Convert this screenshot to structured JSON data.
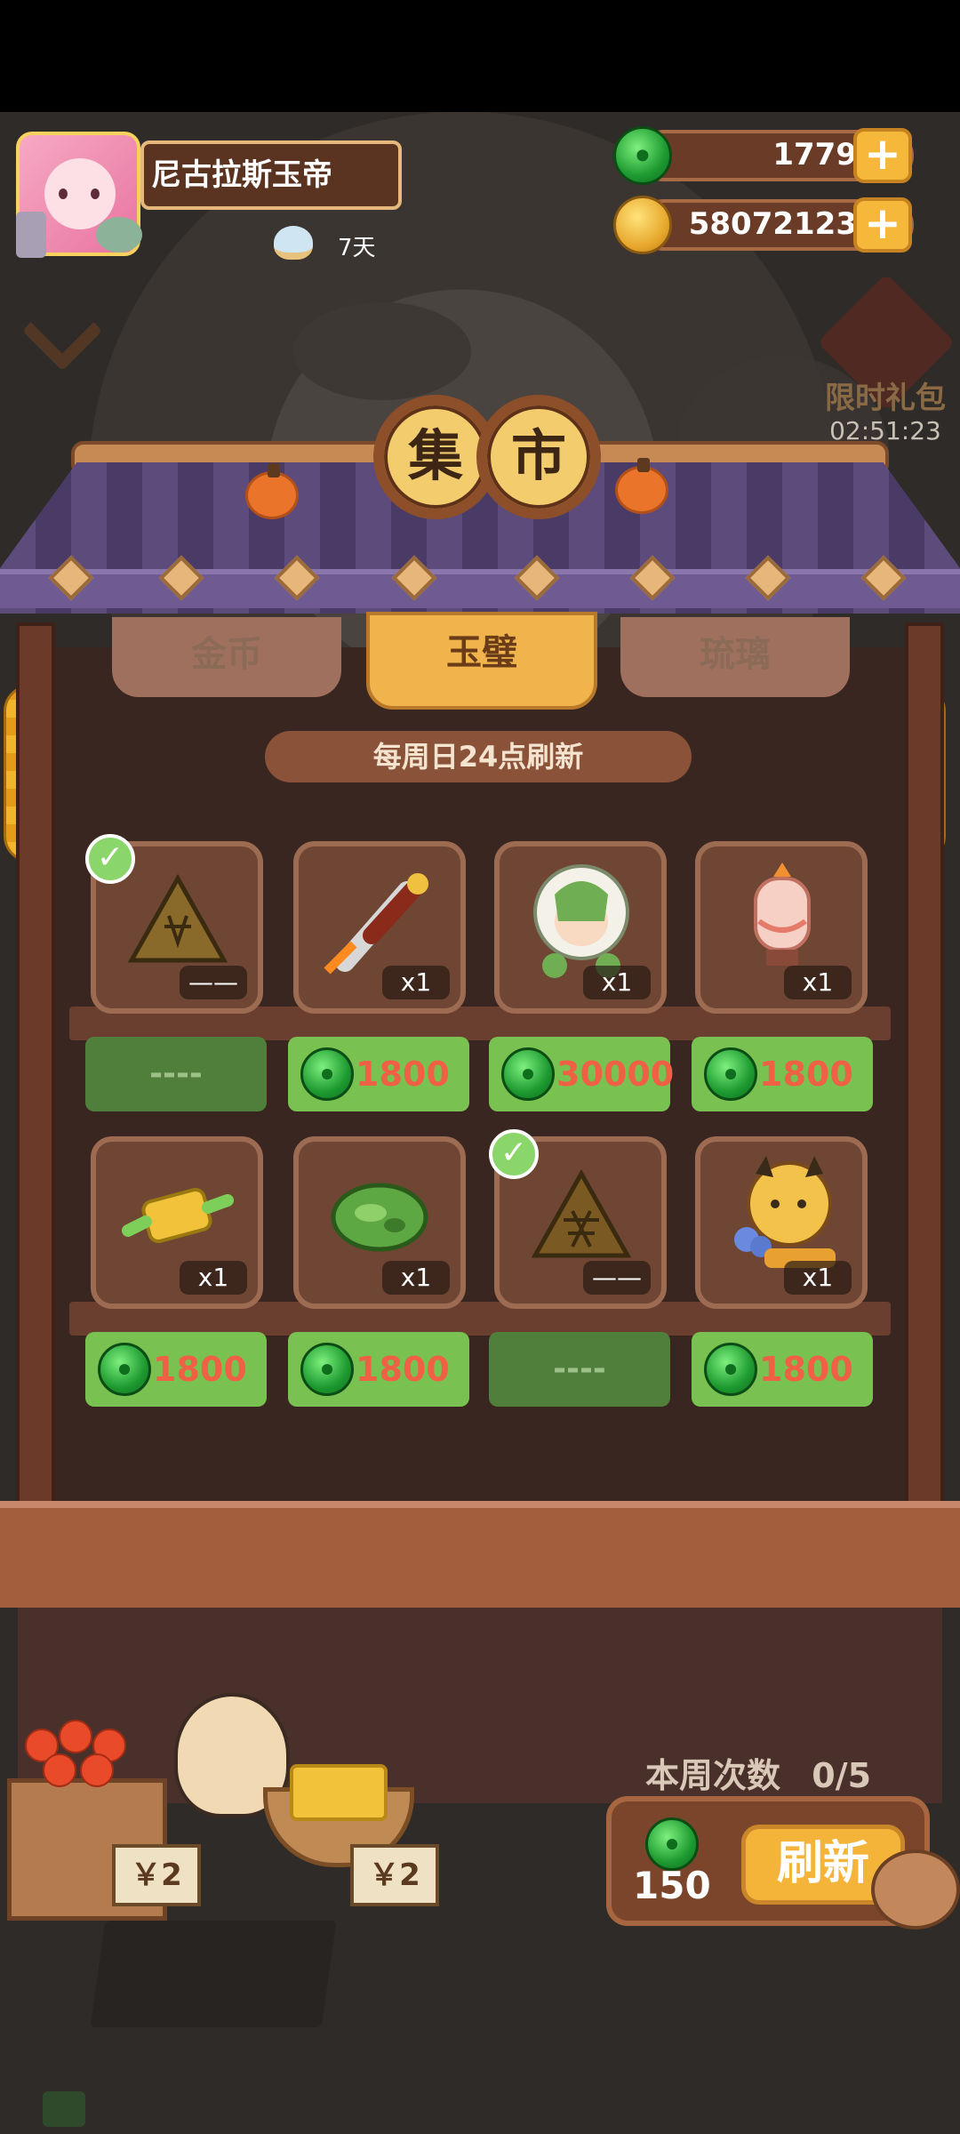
{
  "profile": {
    "name": "尼古拉斯玉帝",
    "days": "7天"
  },
  "currencies": {
    "jade": "1779",
    "gold": "58072123"
  },
  "limited_pack": {
    "label": "限时礼包",
    "timer": "02:51:23"
  },
  "market_title": [
    "集",
    "市"
  ],
  "tabs": [
    {
      "label": "金币",
      "active": false
    },
    {
      "label": "玉璧",
      "active": true
    },
    {
      "label": "琉璃",
      "active": false
    }
  ],
  "refresh_note": "每周日24点刷新",
  "items": [
    {
      "name": "sketch-triangle",
      "qty": "——",
      "price": "----",
      "purchased": true
    },
    {
      "name": "ornate-brush",
      "qty": "x1",
      "price": "1800",
      "purchased": false
    },
    {
      "name": "green-hooded-character",
      "qty": "x1",
      "price": "30000",
      "purchased": false
    },
    {
      "name": "lantern",
      "qty": "x1",
      "price": "1800",
      "purchased": false
    },
    {
      "name": "jade-pendant",
      "qty": "x1",
      "price": "1800",
      "purchased": false
    },
    {
      "name": "jade-stone",
      "qty": "x1",
      "price": "1800",
      "purchased": false
    },
    {
      "name": "sketch-triangle-2",
      "qty": "——",
      "price": "----",
      "purchased": true
    },
    {
      "name": "cat-with-flowers",
      "qty": "x1",
      "price": "1800",
      "purchased": false
    }
  ],
  "week_count": {
    "label": "本周次数",
    "value": "0/5"
  },
  "refresh": {
    "cost": "150",
    "label": "刷新"
  },
  "vendor_tags": [
    "￥2",
    "￥2"
  ],
  "colors": {
    "jade_green": "#79c251",
    "price_red": "#f06044",
    "gold_accent": "#f4b43a",
    "roof_purple": "#5c4b7b"
  }
}
